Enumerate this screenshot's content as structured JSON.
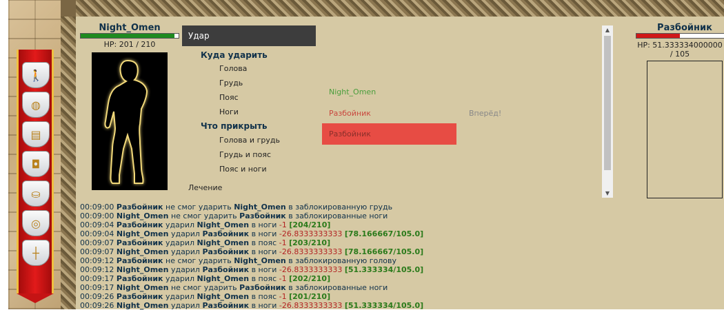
{
  "player": {
    "name": "Night_Omen",
    "hp_text": "HP: 201 / 210",
    "hp_fraction": 0.957
  },
  "enemy": {
    "name": "Разбойник",
    "hp_text_line1": "HP: 51.333334000000",
    "hp_text_line2": "/ 105",
    "hp_fraction": 0.489
  },
  "menu": {
    "header": "Удар",
    "attack_section": "Куда ударить",
    "attack_targets": [
      "Голова",
      "Грудь",
      "Пояс",
      "Ноги"
    ],
    "block_section": "Что прикрыть",
    "block_targets": [
      "Голова и грудь",
      "Грудь и пояс",
      "Пояс и ноги"
    ],
    "heal": "Лечение"
  },
  "targets": {
    "self": "Night_Omen",
    "enemy_1": "Разбойник",
    "enemy_2": "Разбойник",
    "forward": "Вперёд!"
  },
  "colors": {
    "banner": "#d01818",
    "player_hp": "#1f8a1f",
    "enemy_hp": "#d01818",
    "selected_target": "#e74c44"
  },
  "banner_icons": [
    "warrior-icon",
    "globe-icon",
    "scroll-icon",
    "chest-icon",
    "bag-icon",
    "coins-icon",
    "pillar-icon"
  ],
  "log": [
    {
      "time": "00:09:00",
      "attacker": "Разбойник",
      "verb": "не смог ударить",
      "target": "Night_Omen",
      "rest": "в заблокированную грудь",
      "dmg": "",
      "hp": ""
    },
    {
      "time": "00:09:00",
      "attacker": "Night_Omen",
      "verb": "не смог ударить",
      "target": "Разбойник",
      "rest": "в заблокированные ноги",
      "dmg": "",
      "hp": ""
    },
    {
      "time": "00:09:04",
      "attacker": "Разбойник",
      "verb": "ударил",
      "target": "Night_Omen",
      "rest": "в ноги",
      "dmg": "-1",
      "hp": "[204/210]"
    },
    {
      "time": "00:09:04",
      "attacker": "Night_Omen",
      "verb": "ударил",
      "target": "Разбойник",
      "rest": "в ноги",
      "dmg": "-26.8333333333",
      "hp": "[78.166667/105.0]"
    },
    {
      "time": "00:09:07",
      "attacker": "Разбойник",
      "verb": "ударил",
      "target": "Night_Omen",
      "rest": "в пояс",
      "dmg": "-1",
      "hp": "[203/210]"
    },
    {
      "time": "00:09:07",
      "attacker": "Night_Omen",
      "verb": "ударил",
      "target": "Разбойник",
      "rest": "в ноги",
      "dmg": "-26.8333333333",
      "hp": "[78.166667/105.0]"
    },
    {
      "time": "00:09:12",
      "attacker": "Разбойник",
      "verb": "не смог ударить",
      "target": "Night_Omen",
      "rest": "в заблокированную голову",
      "dmg": "",
      "hp": ""
    },
    {
      "time": "00:09:12",
      "attacker": "Night_Omen",
      "verb": "ударил",
      "target": "Разбойник",
      "rest": "в ноги",
      "dmg": "-26.8333333333",
      "hp": "[51.333334/105.0]"
    },
    {
      "time": "00:09:17",
      "attacker": "Разбойник",
      "verb": "ударил",
      "target": "Night_Omen",
      "rest": "в пояс",
      "dmg": "-1",
      "hp": "[202/210]"
    },
    {
      "time": "00:09:17",
      "attacker": "Night_Omen",
      "verb": "не смог ударить",
      "target": "Разбойник",
      "rest": "в заблокированные ноги",
      "dmg": "",
      "hp": ""
    },
    {
      "time": "00:09:26",
      "attacker": "Разбойник",
      "verb": "ударил",
      "target": "Night_Omen",
      "rest": "в пояс",
      "dmg": "-1",
      "hp": "[201/210]"
    },
    {
      "time": "00:09:26",
      "attacker": "Night_Omen",
      "verb": "ударил",
      "target": "Разбойник",
      "rest": "в ноги",
      "dmg": "-26.8333333333",
      "hp": "[51.333334/105.0]"
    }
  ]
}
